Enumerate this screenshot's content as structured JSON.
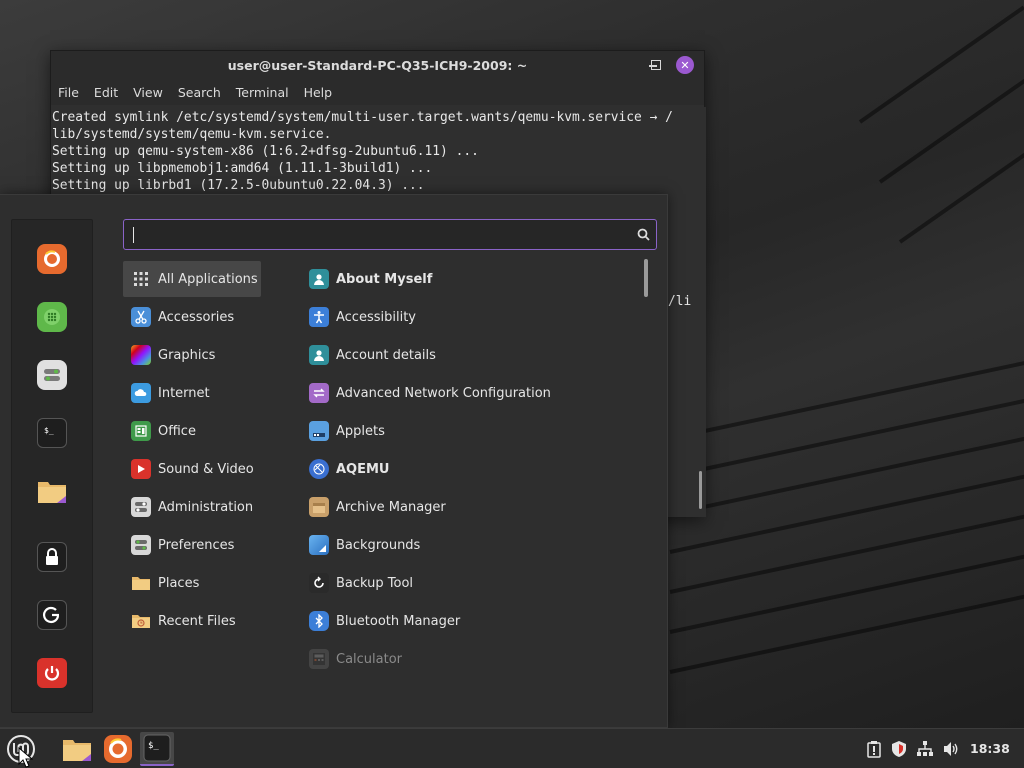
{
  "terminal": {
    "title": "user@user-Standard-PC-Q35-ICH9-2009: ~",
    "menu": [
      "File",
      "Edit",
      "View",
      "Search",
      "Terminal",
      "Help"
    ],
    "lines": [
      "Created symlink /etc/systemd/system/multi-user.target.wants/qemu-kvm.service → /",
      "lib/systemd/system/qemu-kvm.service.",
      "Setting up qemu-system-x86 (1:6.2+dfsg-2ubuntu6.11) ...",
      "Setting up libpmemobj1:amd64 (1.11.1-3build1) ...",
      "Setting up librbd1 (17.2.5-0ubuntu0.22.04.3) ..."
    ],
    "partial_text": "/li"
  },
  "start_menu": {
    "search": {
      "value": "",
      "placeholder": ""
    },
    "favorites": [
      {
        "name": "firefox-icon",
        "color": "#e66a2e"
      },
      {
        "name": "software-manager-icon",
        "color": "#5fb84a"
      },
      {
        "name": "settings-icon",
        "color": "#e0e0e0"
      },
      {
        "name": "terminal-icon",
        "color": "#1e1e1e"
      },
      {
        "name": "files-icon",
        "color": "#e8b96a"
      },
      {
        "name": "lock-screen-icon",
        "color": "#1e1e1e"
      },
      {
        "name": "logout-icon",
        "color": "#1e1e1e"
      },
      {
        "name": "power-icon",
        "color": "#d9322b"
      }
    ],
    "categories": [
      {
        "label": "All Applications",
        "icon": "grid-icon",
        "color": "#474747"
      },
      {
        "label": "Accessories",
        "icon": "scissors-icon",
        "color": "#4a8fd8"
      },
      {
        "label": "Graphics",
        "icon": "graphics-icon",
        "color": "#c84fd0"
      },
      {
        "label": "Internet",
        "icon": "cloud-icon",
        "color": "#3c9be0"
      },
      {
        "label": "Office",
        "icon": "office-icon",
        "color": "#3f9a4a"
      },
      {
        "label": "Sound & Video",
        "icon": "play-icon",
        "color": "#d9322b"
      },
      {
        "label": "Administration",
        "icon": "toggle-icon",
        "color": "#d8d8d8"
      },
      {
        "label": "Preferences",
        "icon": "preferences-icon",
        "color": "#d8d8d8"
      },
      {
        "label": "Places",
        "icon": "folder-icon",
        "color": "#e8b96a"
      },
      {
        "label": "Recent Files",
        "icon": "recent-folder-icon",
        "color": "#e8b96a"
      }
    ],
    "applications": [
      {
        "label": "About Myself",
        "icon": "user-icon",
        "color": "#2f8f9a",
        "bold": true
      },
      {
        "label": "Accessibility",
        "icon": "accessibility-icon",
        "color": "#3c7fd8",
        "bold": false
      },
      {
        "label": "Account details",
        "icon": "account-icon",
        "color": "#2f8f9a",
        "bold": false
      },
      {
        "label": "Advanced Network Configuration",
        "icon": "network-config-icon",
        "color": "#a36ac8",
        "bold": false
      },
      {
        "label": "Applets",
        "icon": "applets-icon",
        "color": "#5aa0e0",
        "bold": false
      },
      {
        "label": "AQEMU",
        "icon": "aqemu-icon",
        "color": "#3a6fd0",
        "bold": true
      },
      {
        "label": "Archive Manager",
        "icon": "archive-icon",
        "color": "#c9a06a",
        "bold": false
      },
      {
        "label": "Backgrounds",
        "icon": "backgrounds-icon",
        "color": "#4a90e0",
        "bold": false
      },
      {
        "label": "Backup Tool",
        "icon": "backup-icon",
        "color": "#2a2a2a",
        "bold": false
      },
      {
        "label": "Bluetooth Manager",
        "icon": "bluetooth-icon",
        "color": "#3c7fd8",
        "bold": false
      },
      {
        "label": "Calculator",
        "icon": "calculator-icon",
        "color": "#5a5a5a",
        "bold": false
      }
    ]
  },
  "taskbar": {
    "clock": "18:38",
    "accent": "#8a63c8"
  }
}
